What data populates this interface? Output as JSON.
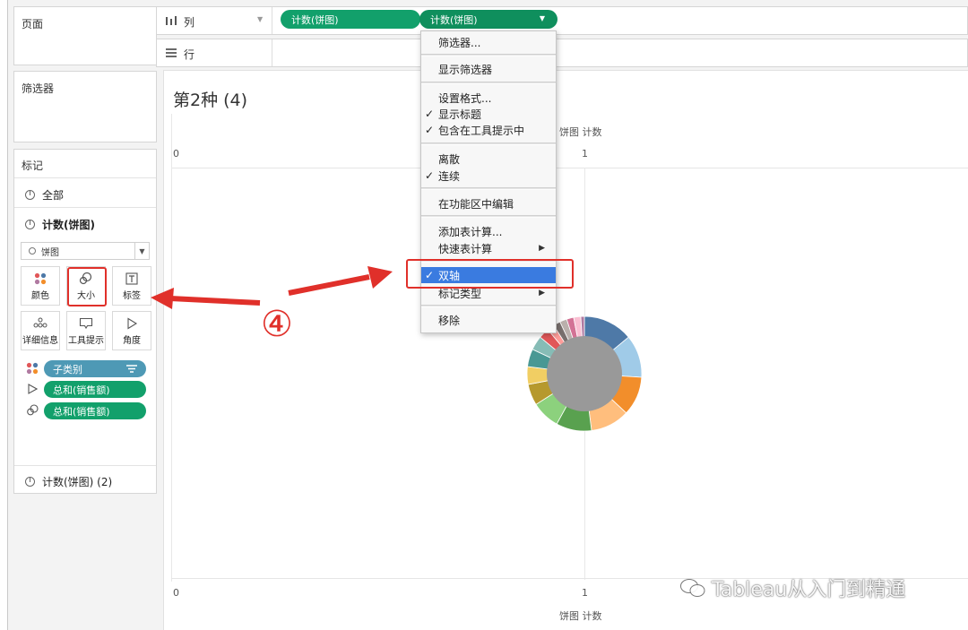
{
  "left": {
    "pages_title": "页面",
    "filters_title": "筛选器",
    "marks_title": "标记",
    "marks_all": "全部",
    "marks_layer1": "计数(饼图)",
    "mark_type": "饼图",
    "buttons": {
      "color": "颜色",
      "size": "大小",
      "label": "标签",
      "detail": "详细信息",
      "tooltip": "工具提示",
      "angle": "角度"
    },
    "fields": [
      {
        "label": "子类别",
        "kind": "color",
        "pill_color": "#4e99b5"
      },
      {
        "label": "总和(销售额)",
        "kind": "angle",
        "pill_color": "#12a06b"
      },
      {
        "label": "总和(销售额)",
        "kind": "size",
        "pill_color": "#12a06b"
      }
    ],
    "marks_layer2": "计数(饼图) (2)"
  },
  "shelves": {
    "columns_label": "列",
    "rows_label": "行",
    "col_pill_1": "计数(饼图)",
    "col_pill_2": "计数(饼图)"
  },
  "view": {
    "title": "第2种 (4)",
    "axis_title_top": "饼图 计数",
    "axis_title_bottom": "饼图 计数",
    "tick_0": "0",
    "tick_1": "1"
  },
  "menu": {
    "items": [
      {
        "label": "筛选器...",
        "checked": false,
        "submenu": false
      },
      {
        "label": "显示筛选器",
        "checked": false,
        "submenu": false
      },
      {
        "label": "设置格式...",
        "checked": false,
        "submenu": false
      },
      {
        "label": "显示标题",
        "checked": true,
        "submenu": false
      },
      {
        "label": "包含在工具提示中",
        "checked": true,
        "submenu": false
      },
      {
        "label": "离散",
        "checked": false,
        "submenu": false
      },
      {
        "label": "连续",
        "checked": true,
        "submenu": false
      },
      {
        "label": "在功能区中编辑",
        "checked": false,
        "submenu": false
      },
      {
        "label": "添加表计算...",
        "checked": false,
        "submenu": false
      },
      {
        "label": "快速表计算",
        "checked": false,
        "submenu": true
      },
      {
        "label": "双轴",
        "checked": true,
        "submenu": false,
        "highlighted": true
      },
      {
        "label": "标记类型",
        "checked": false,
        "submenu": true
      },
      {
        "label": "移除",
        "checked": false,
        "submenu": false
      }
    ],
    "check_glyph": "✓",
    "submenu_glyph": "▶"
  },
  "annotation": {
    "step_number": "④",
    "accent_color": "#e0302a"
  },
  "watermark": "Tableau从入门到精通",
  "donut": {
    "inner_color": "#999999",
    "segments": [
      {
        "color": "#4e79a7",
        "value": 14
      },
      {
        "color": "#a0cbe8",
        "value": 12
      },
      {
        "color": "#f28e2b",
        "value": 11
      },
      {
        "color": "#ffbe7d",
        "value": 11
      },
      {
        "color": "#59a14f",
        "value": 10
      },
      {
        "color": "#8cd17d",
        "value": 8
      },
      {
        "color": "#b6992d",
        "value": 6
      },
      {
        "color": "#f1ce63",
        "value": 5
      },
      {
        "color": "#499894",
        "value": 5
      },
      {
        "color": "#86bcb6",
        "value": 4
      },
      {
        "color": "#e15759",
        "value": 3
      },
      {
        "color": "#ff9d9a",
        "value": 2
      },
      {
        "color": "#79706e",
        "value": 2
      },
      {
        "color": "#bab0ac",
        "value": 2
      },
      {
        "color": "#d37295",
        "value": 2
      },
      {
        "color": "#fabfd2",
        "value": 2
      },
      {
        "color": "#b07aa1",
        "value": 1
      }
    ]
  }
}
